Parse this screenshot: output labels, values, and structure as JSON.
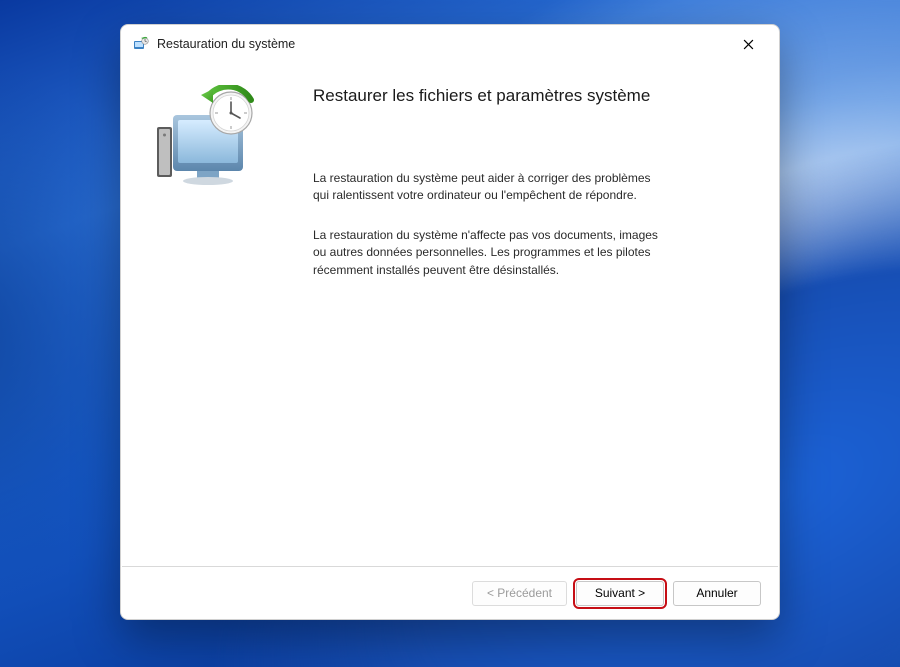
{
  "window": {
    "title": "Restauration du système"
  },
  "content": {
    "heading": "Restaurer les fichiers et paramètres système",
    "paragraph1": "La restauration du système peut aider à corriger des problèmes qui ralentissent votre ordinateur ou l'empêchent de répondre.",
    "paragraph2": "La restauration du système n'affecte pas vos documents, images ou autres données personnelles. Les programmes et les pilotes récemment installés peuvent être désinstallés."
  },
  "buttons": {
    "back": "< Précédent",
    "next": "Suivant >",
    "cancel": "Annuler"
  }
}
